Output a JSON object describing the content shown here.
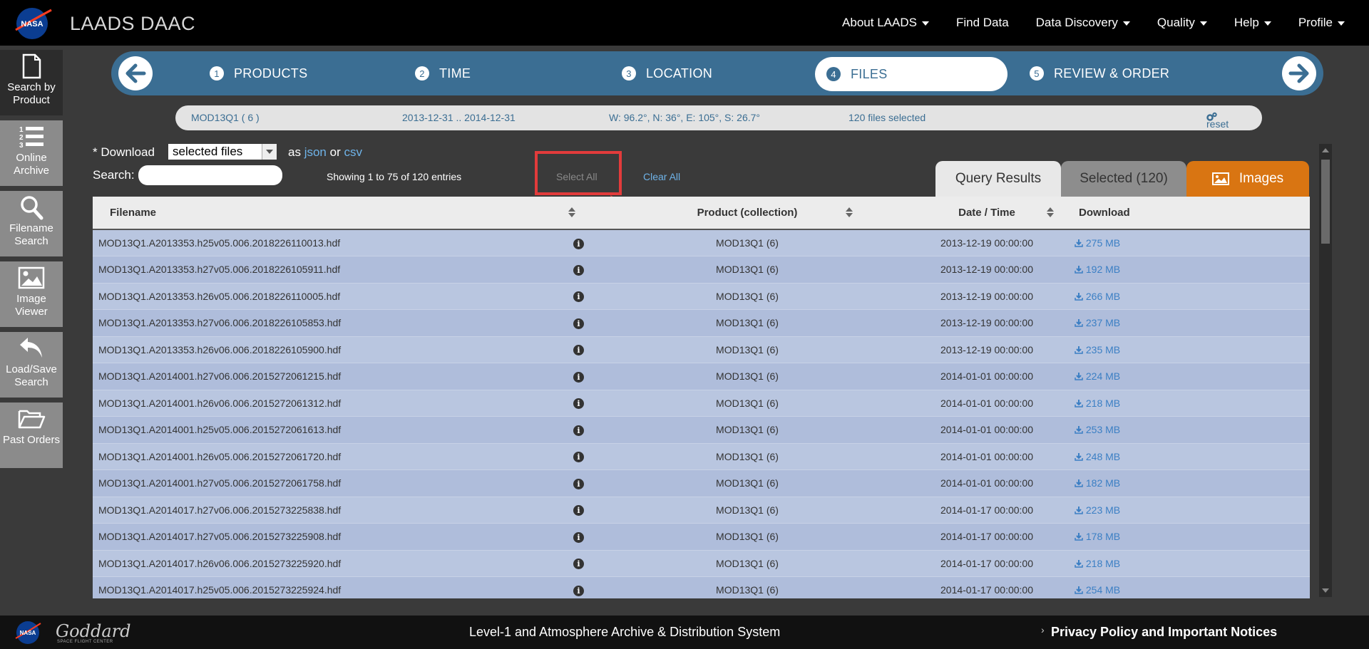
{
  "app": {
    "title": "LAADS DAAC",
    "logo": "NASA"
  },
  "topnav": [
    {
      "label": "About LAADS",
      "caret": true
    },
    {
      "label": "Find Data",
      "caret": false
    },
    {
      "label": "Data Discovery",
      "caret": true
    },
    {
      "label": "Quality",
      "caret": true
    },
    {
      "label": "Help",
      "caret": true
    },
    {
      "label": "Profile",
      "caret": true
    }
  ],
  "sidebar": [
    {
      "label": "Search by Product",
      "icon": "document-icon",
      "active": true
    },
    {
      "label": "Online Archive",
      "icon": "list-icon",
      "active": false
    },
    {
      "label": "Filename Search",
      "icon": "magnifier-icon",
      "active": false
    },
    {
      "label": "Image Viewer",
      "icon": "image-icon",
      "active": false
    },
    {
      "label": "Load/Save Search",
      "icon": "undo-icon",
      "active": false
    },
    {
      "label": "Past Orders",
      "icon": "folder-icon",
      "active": false
    }
  ],
  "wizard": {
    "steps": [
      {
        "num": "1",
        "label": "PRODUCTS"
      },
      {
        "num": "2",
        "label": "TIME"
      },
      {
        "num": "3",
        "label": "LOCATION"
      },
      {
        "num": "4",
        "label": "FILES"
      },
      {
        "num": "5",
        "label": "REVIEW & ORDER"
      }
    ],
    "active_step": "FILES"
  },
  "summary": {
    "product": "MOD13Q1 ( 6 )",
    "dates": "2013-12-31 .. 2014-12-31",
    "bbox": "W: 96.2°, N: 36°, E: 105°, S: 26.7°",
    "files": "120 files selected",
    "reset": "reset"
  },
  "controls": {
    "download_label": "* Download",
    "download_value": "selected files",
    "as_label": "as",
    "json": "json",
    "or_label": "or",
    "csv": "csv",
    "search_label": "Search:",
    "search_value": "",
    "showing": "Showing 1 to 75 of 120 entries",
    "select_all": "Select All",
    "clear_all": "Clear All"
  },
  "tabs": {
    "query": "Query Results",
    "selected": "Selected (120)",
    "images": "Images"
  },
  "table": {
    "headers": {
      "filename": "Filename",
      "product": "Product (collection)",
      "date": "Date / Time",
      "download": "Download"
    },
    "rows": [
      {
        "file": "MOD13Q1.A2013353.h25v05.006.2018226110013.hdf",
        "product": "MOD13Q1 (6)",
        "date": "2013-12-19 00:00:00",
        "size": "275 MB"
      },
      {
        "file": "MOD13Q1.A2013353.h27v05.006.2018226105911.hdf",
        "product": "MOD13Q1 (6)",
        "date": "2013-12-19 00:00:00",
        "size": "192 MB"
      },
      {
        "file": "MOD13Q1.A2013353.h26v05.006.2018226110005.hdf",
        "product": "MOD13Q1 (6)",
        "date": "2013-12-19 00:00:00",
        "size": "266 MB"
      },
      {
        "file": "MOD13Q1.A2013353.h27v06.006.2018226105853.hdf",
        "product": "MOD13Q1 (6)",
        "date": "2013-12-19 00:00:00",
        "size": "237 MB"
      },
      {
        "file": "MOD13Q1.A2013353.h26v06.006.2018226105900.hdf",
        "product": "MOD13Q1 (6)",
        "date": "2013-12-19 00:00:00",
        "size": "235 MB"
      },
      {
        "file": "MOD13Q1.A2014001.h27v06.006.2015272061215.hdf",
        "product": "MOD13Q1 (6)",
        "date": "2014-01-01 00:00:00",
        "size": "224 MB"
      },
      {
        "file": "MOD13Q1.A2014001.h26v06.006.2015272061312.hdf",
        "product": "MOD13Q1 (6)",
        "date": "2014-01-01 00:00:00",
        "size": "218 MB"
      },
      {
        "file": "MOD13Q1.A2014001.h25v05.006.2015272061613.hdf",
        "product": "MOD13Q1 (6)",
        "date": "2014-01-01 00:00:00",
        "size": "253 MB"
      },
      {
        "file": "MOD13Q1.A2014001.h26v05.006.2015272061720.hdf",
        "product": "MOD13Q1 (6)",
        "date": "2014-01-01 00:00:00",
        "size": "248 MB"
      },
      {
        "file": "MOD13Q1.A2014001.h27v05.006.2015272061758.hdf",
        "product": "MOD13Q1 (6)",
        "date": "2014-01-01 00:00:00",
        "size": "182 MB"
      },
      {
        "file": "MOD13Q1.A2014017.h27v06.006.2015273225838.hdf",
        "product": "MOD13Q1 (6)",
        "date": "2014-01-17 00:00:00",
        "size": "223 MB"
      },
      {
        "file": "MOD13Q1.A2014017.h27v05.006.2015273225908.hdf",
        "product": "MOD13Q1 (6)",
        "date": "2014-01-17 00:00:00",
        "size": "178 MB"
      },
      {
        "file": "MOD13Q1.A2014017.h26v06.006.2015273225920.hdf",
        "product": "MOD13Q1 (6)",
        "date": "2014-01-17 00:00:00",
        "size": "218 MB"
      },
      {
        "file": "MOD13Q1.A2014017.h25v05.006.2015273225924.hdf",
        "product": "MOD13Q1 (6)",
        "date": "2014-01-17 00:00:00",
        "size": "254 MB"
      }
    ]
  },
  "footer": {
    "goddard": "Goddard",
    "goddard_sub": "SPACE FLIGHT CENTER",
    "center": "Level-1 and Atmosphere Archive & Distribution System",
    "right": "Privacy Policy and Important Notices"
  },
  "colors": {
    "accent": "#3b6e93",
    "link": "#6fb3e8",
    "images_tab": "#d97512",
    "highlight": "#e23b3b"
  }
}
